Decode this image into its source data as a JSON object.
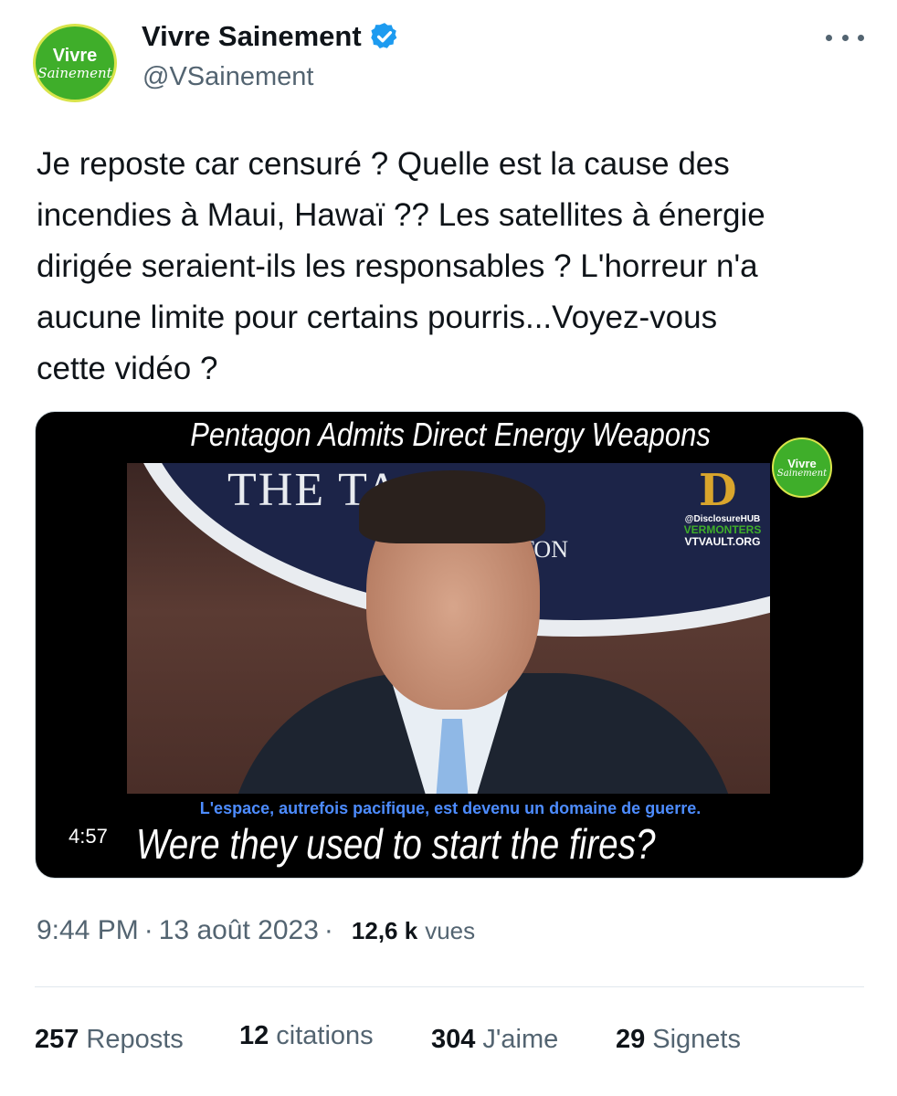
{
  "account": {
    "name": "Vivre Sainement",
    "handle": "@VSainement",
    "avatar_line1": "Vivre",
    "avatar_line2": "Sainement",
    "verified_icon": "verified-badge-icon",
    "accent_color": "#1d9bf0"
  },
  "tweet": {
    "text": "Je reposte car censuré ? Quelle est la cause des\nincendies à Maui, Hawaï ?? Les satellites à énergie\ndirigée seraient-ils les responsables ? L'horreur n'a\naucune limite pour certains pourris...Voyez-vous\ncette vidéo ?"
  },
  "video": {
    "title": "Pentagon Admits Direct Energy Weapons",
    "seal_text": "THE   TAGO",
    "seal_subtext": "TON",
    "subtitle": "L'espace, autrefois pacifique, est devenu un domaine de guerre.",
    "caption": "Were they used to start the fires?",
    "duration": "4:57",
    "watermark_logo_line1": "Vivre",
    "watermark_logo_line2": "Sainement",
    "watermark_d": "D",
    "watermark_hub": "@DisclosureHUB",
    "watermark_vermonters": "VERMONTERS",
    "watermark_vault": "VTVAULT.ORG"
  },
  "meta": {
    "time": "9:44 PM",
    "separator": "·",
    "date": "13 août 2023",
    "views_count": "12,6 k",
    "views_label": "vues"
  },
  "stats": {
    "reposts_count": "257",
    "reposts_label": "Reposts",
    "quotes_count": "12",
    "quotes_label": "citations",
    "likes_count": "304",
    "likes_label": "J'aime",
    "bookmarks_count": "29",
    "bookmarks_label": "Signets"
  }
}
